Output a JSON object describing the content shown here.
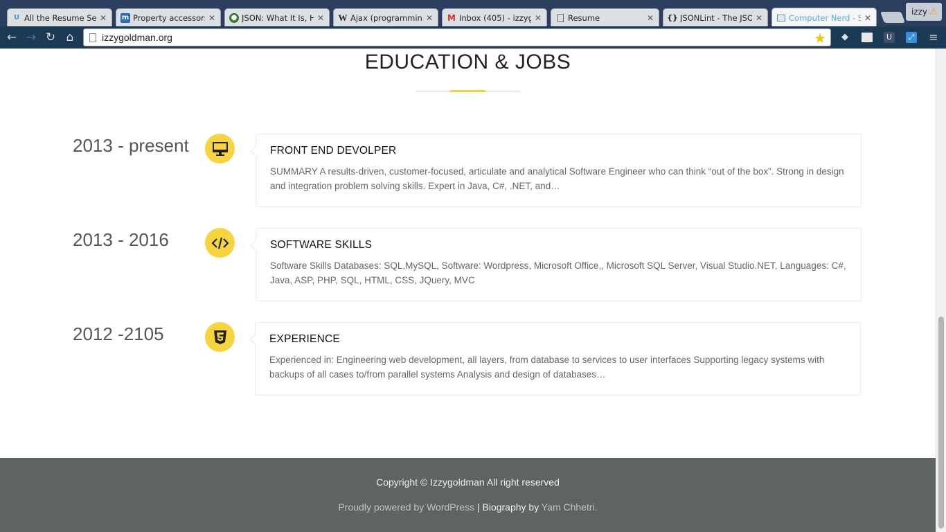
{
  "browser": {
    "tabs": [
      {
        "title": "All the Resume Sect",
        "icon": "u-favicon-icon",
        "active": false
      },
      {
        "title": "Property accessors",
        "icon": "mdn-favicon-icon",
        "active": false
      },
      {
        "title": "JSON: What It Is, Ho",
        "icon": "json-favicon-icon",
        "active": false
      },
      {
        "title": "Ajax (programming",
        "icon": "wikipedia-favicon-icon",
        "active": false
      },
      {
        "title": "Inbox (405) - izzyg",
        "icon": "gmail-favicon-icon",
        "active": false
      },
      {
        "title": "Resume",
        "icon": "document-favicon-icon",
        "active": false
      },
      {
        "title": "JSONLint - The JSON",
        "icon": "jsonlint-favicon-icon",
        "active": false
      },
      {
        "title": "Computer Nerd - S",
        "icon": "site-favicon-icon",
        "active": true
      }
    ],
    "profile_name": "izzy",
    "url": "izzygoldman.org"
  },
  "page": {
    "section_title": "EDUCATION & JOBS",
    "entries": [
      {
        "year": "2013 - present",
        "icon": "desktop-monitor-icon",
        "title": "FRONT END DEVOLPER",
        "text": "SUMMARY A results-driven, customer-focused, articulate and analytical Software Engineer who can think “out of the box”. Strong in design and integration problem solving skills. Expert in Java, C#, .NET, and…"
      },
      {
        "year": "2013 - 2016",
        "icon": "code-brackets-icon",
        "title": "SOFTWARE SKILLS",
        "text": "Software Skills Databases: SQL,MySQL, Software: Wordpress, Microsoft Office,, Microsoft SQL Server,  Visual Studio.NET, Languages: C#, Java, ASP, PHP, SQL, HTML, CSS, JQuery, MVC"
      },
      {
        "year": "2012 -2105",
        "icon": "css3-logo-icon",
        "title": "EXPERIENCE",
        "text": "Experienced in: Engineering web development, all layers, from database to services to user interfaces Supporting legacy systems with backups of all cases to/from parallel systems Analysis and design of databases…"
      }
    ]
  },
  "footer": {
    "copyright": "Copyright © Izzygoldman All right reserved",
    "powered_link": "Proudly powered by WordPress",
    "separator": " | Biography by ",
    "theme_author": "Yam Chhetri",
    "period": "."
  },
  "colors": {
    "accent": "#f6d43f",
    "footer_bg": "#5e6363",
    "tabstrip_bg": "#2b3e5e",
    "toolbar_bg": "#1d3a55"
  }
}
